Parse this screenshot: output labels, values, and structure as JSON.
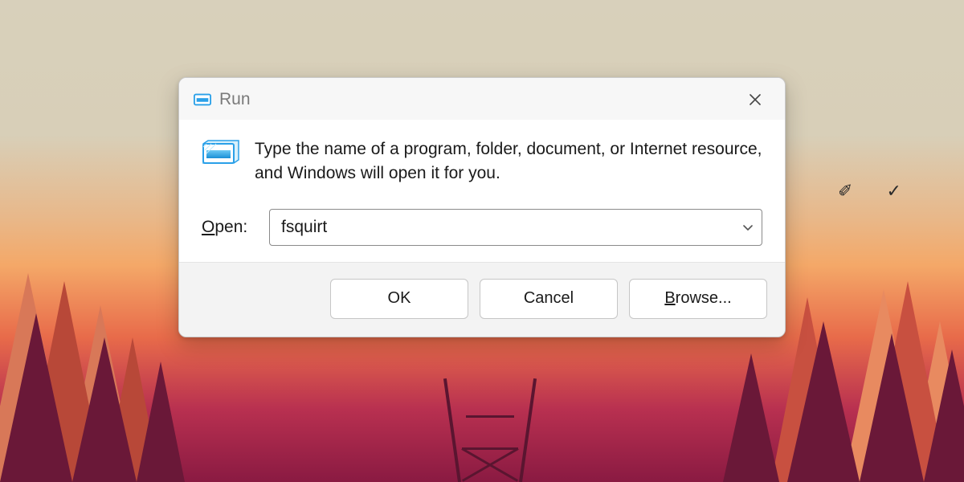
{
  "dialog": {
    "title": "Run",
    "description": "Type the name of a program, folder, document, or Internet resource, and Windows will open it for you.",
    "open_label_underline": "O",
    "open_label_rest": "pen:",
    "input_value": "fsquirt",
    "buttons": {
      "ok": "OK",
      "cancel": "Cancel",
      "browse_underline": "B",
      "browse_rest": "rowse..."
    }
  }
}
